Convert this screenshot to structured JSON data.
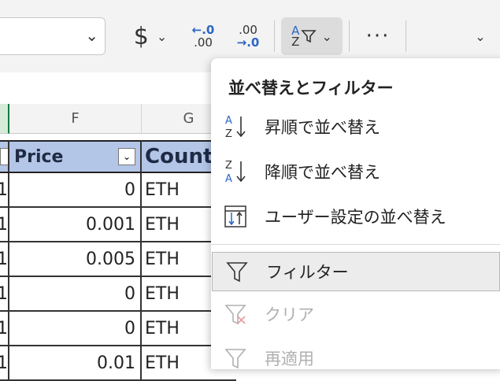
{
  "ribbon": {
    "currency_symbol": "$",
    "increase_decimal_top": "←.0",
    "increase_decimal_bottom": ".00",
    "decrease_decimal_top": ".00",
    "decrease_decimal_bottom": "→.0",
    "more_label": "···",
    "sort_filter_icon_a": "A",
    "sort_filter_icon_z": "Z",
    "accent_color": "#2b66c4"
  },
  "sheet": {
    "columns": [
      {
        "letter": "F"
      },
      {
        "letter": "G"
      }
    ],
    "headers": {
      "price": "Price",
      "count": "Count"
    },
    "rows": [
      {
        "e": "1",
        "price": "0",
        "currency": "ETH"
      },
      {
        "e": "1",
        "price": "0.001",
        "currency": "ETH"
      },
      {
        "e": "1",
        "price": "0.005",
        "currency": "ETH"
      },
      {
        "e": "1",
        "price": "0",
        "currency": "ETH"
      },
      {
        "e": "1",
        "price": "0",
        "currency": "ETH"
      },
      {
        "e": "1",
        "price": "0.01",
        "currency": "ETH"
      }
    ],
    "header_fill": "#b4c6e7",
    "selection_color": "#107c41"
  },
  "menu": {
    "title": "並べ替えとフィルター",
    "items": [
      {
        "label": "昇順で並べ替え",
        "icon": "sort-ascending-icon",
        "enabled": true
      },
      {
        "label": "降順で並べ替え",
        "icon": "sort-descending-icon",
        "enabled": true
      },
      {
        "label": "ユーザー設定の並べ替え",
        "icon": "custom-sort-icon",
        "enabled": true
      },
      {
        "label": "フィルター",
        "icon": "filter-icon",
        "enabled": true,
        "highlighted": true
      },
      {
        "label": "クリア",
        "icon": "clear-filter-icon",
        "enabled": false
      },
      {
        "label": "再適用",
        "icon": "reapply-filter-icon",
        "enabled": false
      }
    ]
  }
}
